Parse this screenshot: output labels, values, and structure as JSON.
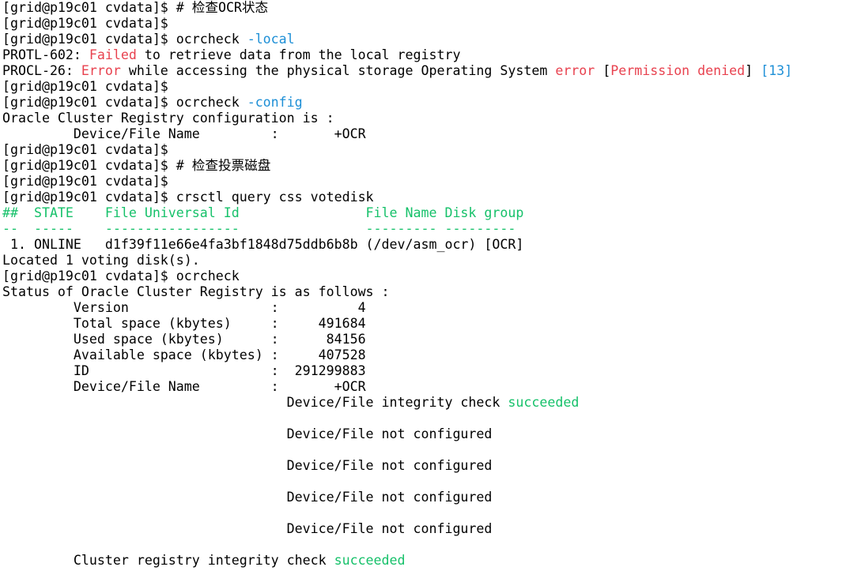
{
  "palette": {
    "default": "#000000",
    "red": "#e8424f",
    "blue": "#1d8fd6",
    "green": "#16c16a",
    "background": "#ffffff"
  },
  "terminal": {
    "lines": [
      [
        {
          "t": "[grid@p19c01 cvdata]$ # 检查OCR状态"
        }
      ],
      [
        {
          "t": "[grid@p19c01 cvdata]$"
        }
      ],
      [
        {
          "t": "[grid@p19c01 cvdata]$ ocrcheck "
        },
        {
          "t": "-local",
          "c": "blue"
        }
      ],
      [
        {
          "t": "PROTL-602: "
        },
        {
          "t": "Failed",
          "c": "red"
        },
        {
          "t": " to retrieve data from the local registry"
        }
      ],
      [
        {
          "t": "PROCL-26: "
        },
        {
          "t": "Error",
          "c": "red"
        },
        {
          "t": " while accessing the physical storage Operating System "
        },
        {
          "t": "error",
          "c": "red"
        },
        {
          "t": " ["
        },
        {
          "t": "Permission denied",
          "c": "red"
        },
        {
          "t": "] "
        },
        {
          "t": "[13]",
          "c": "blue"
        }
      ],
      [
        {
          "t": "[grid@p19c01 cvdata]$"
        }
      ],
      [
        {
          "t": "[grid@p19c01 cvdata]$ ocrcheck "
        },
        {
          "t": "-config",
          "c": "blue"
        }
      ],
      [
        {
          "t": "Oracle Cluster Registry configuration is :"
        }
      ],
      [
        {
          "t": "         Device/File Name         :       +OCR"
        }
      ],
      [
        {
          "t": "[grid@p19c01 cvdata]$"
        }
      ],
      [
        {
          "t": "[grid@p19c01 cvdata]$ # 检查投票磁盘"
        }
      ],
      [
        {
          "t": "[grid@p19c01 cvdata]$"
        }
      ],
      [
        {
          "t": "[grid@p19c01 cvdata]$ crsctl query css votedisk"
        }
      ],
      [
        {
          "t": "##  STATE    File Universal Id                File Name Disk group",
          "c": "green"
        }
      ],
      [
        {
          "t": "--  -----    -----------------                --------- ---------",
          "c": "green"
        }
      ],
      [
        {
          "t": " 1. ONLINE   d1f39f11e66e4fa3bf1848d75ddb6b8b (/dev/asm_ocr) [OCR]"
        }
      ],
      [
        {
          "t": "Located 1 voting disk(s)."
        }
      ],
      [
        {
          "t": "[grid@p19c01 cvdata]$ ocrcheck"
        }
      ],
      [
        {
          "t": "Status of Oracle Cluster Registry is as follows :"
        }
      ],
      [
        {
          "t": "         Version                  :          4"
        }
      ],
      [
        {
          "t": "         Total space (kbytes)     :     491684"
        }
      ],
      [
        {
          "t": "         Used space (kbytes)      :      84156"
        }
      ],
      [
        {
          "t": "         Available space (kbytes) :     407528"
        }
      ],
      [
        {
          "t": "         ID                       :  291299883"
        }
      ],
      [
        {
          "t": "         Device/File Name         :       +OCR"
        }
      ],
      [
        {
          "t": "                                    Device/File integrity check "
        },
        {
          "t": "succeeded",
          "c": "green"
        }
      ],
      [
        {
          "t": ""
        }
      ],
      [
        {
          "t": "                                    Device/File not configured"
        }
      ],
      [
        {
          "t": ""
        }
      ],
      [
        {
          "t": "                                    Device/File not configured"
        }
      ],
      [
        {
          "t": ""
        }
      ],
      [
        {
          "t": "                                    Device/File not configured"
        }
      ],
      [
        {
          "t": ""
        }
      ],
      [
        {
          "t": "                                    Device/File not configured"
        }
      ],
      [
        {
          "t": ""
        }
      ],
      [
        {
          "t": "         Cluster registry integrity check "
        },
        {
          "t": "succeeded",
          "c": "green"
        }
      ]
    ]
  }
}
